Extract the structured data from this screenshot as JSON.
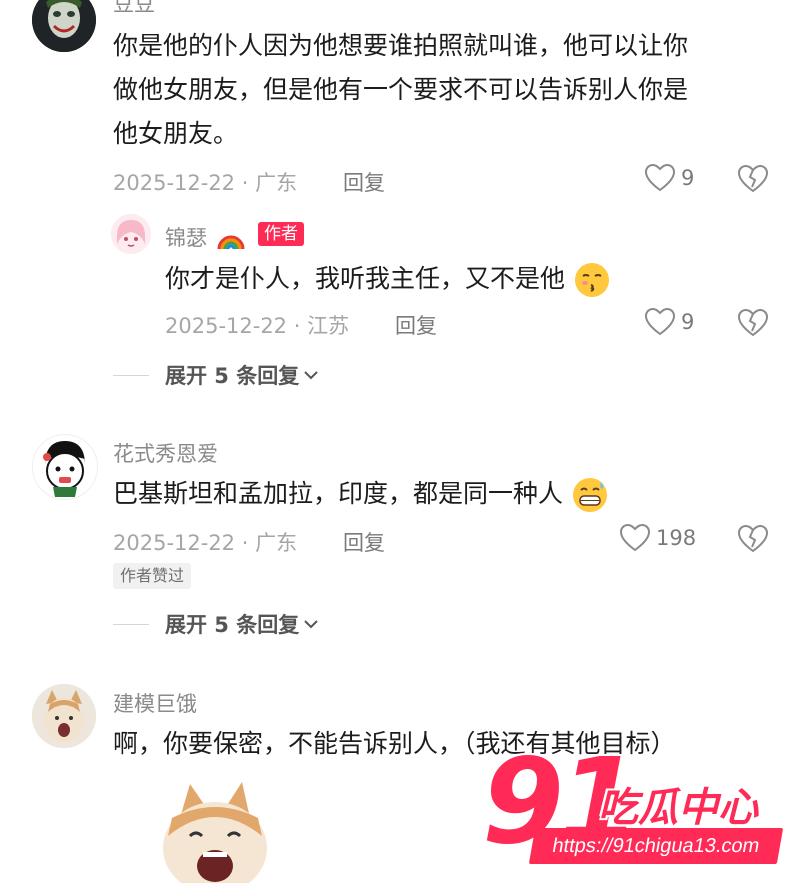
{
  "comments": [
    {
      "username": "豆豆",
      "text_lines": [
        "你是他的仆人因为他想要谁拍照就叫谁，他可以让你",
        "做他女朋友，但是他有一个要求不可以告诉别人你是",
        "他女朋友。"
      ],
      "date_location": "2025-12-22 · 广东",
      "reply_label": "回复",
      "likes": "9",
      "avatar_icon": "joker-avatar"
    },
    {
      "username": "锦瑟",
      "author_tag": "作者",
      "text": "你才是仆人，我听我主任，又不是他",
      "date_location": "2025-12-22 · 江苏",
      "reply_label": "回复",
      "likes": "9",
      "avatar_icon": "pink-girl-avatar"
    },
    {
      "username": "花式秀恩爱",
      "text": "巴基斯坦和孟加拉，印度，都是同一种人",
      "date_location": "2025-12-22 · 广东",
      "reply_label": "回复",
      "likes": "198",
      "liked_tag": "作者赞过",
      "avatar_icon": "cartoon-girl-avatar"
    },
    {
      "username": "建模巨饿",
      "text": "啊，你要保密，不能告诉别人，（我还有其他目标）",
      "avatar_icon": "cat-avatar"
    }
  ],
  "expand_replies": [
    "展开 5 条回复",
    "展开 5 条回复"
  ],
  "watermark": {
    "number": "91",
    "text": "吃瓜中心",
    "url": "https://91chigua13.com"
  },
  "colors": {
    "accent": "#fe2c55",
    "meta": "#a6a6a6",
    "text": "#1c1c1c"
  }
}
